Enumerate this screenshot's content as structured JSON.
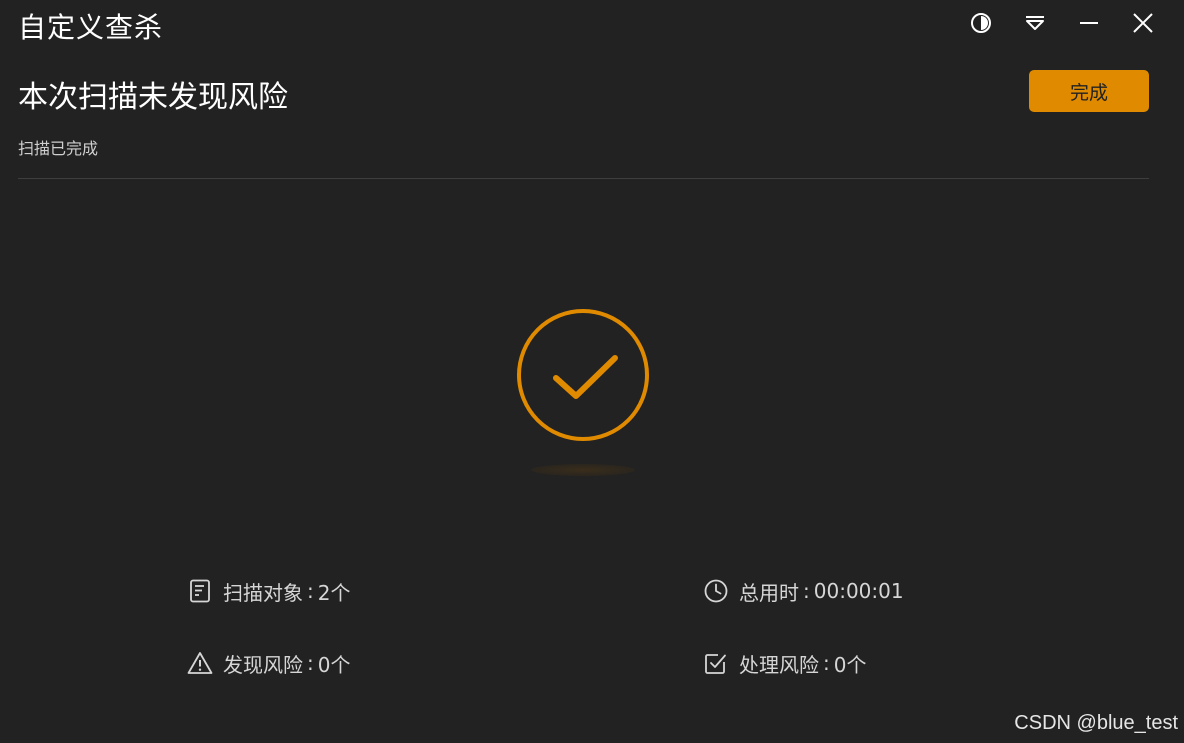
{
  "window": {
    "title": "自定义查杀"
  },
  "controls": {
    "theme_icon": "half-circle-contrast-icon",
    "menu_icon": "dropdown-menu-icon",
    "minimize_icon": "minimize-icon",
    "close_icon": "close-icon"
  },
  "header": {
    "title": "本次扫描未发现风险",
    "subtitle": "扫描已完成",
    "done_label": "完成"
  },
  "stats": {
    "objects": {
      "label": "扫描对象",
      "separator": ":",
      "value": "2个",
      "icon": "document-icon"
    },
    "time": {
      "label": "总用时",
      "separator": ":",
      "value": "00:00:01",
      "icon": "clock-icon"
    },
    "found": {
      "label": "发现风险",
      "separator": ":",
      "value": "0个",
      "icon": "warning-icon"
    },
    "handled": {
      "label": "处理风险",
      "separator": ":",
      "value": "0个",
      "icon": "checkbox-icon"
    }
  },
  "status_icon": "check-circle-icon",
  "colors": {
    "background": "#222222",
    "accent": "#e08a00",
    "text": "#ffffff",
    "muted_text": "#cfcfcf"
  },
  "watermark": "CSDN @blue_test"
}
